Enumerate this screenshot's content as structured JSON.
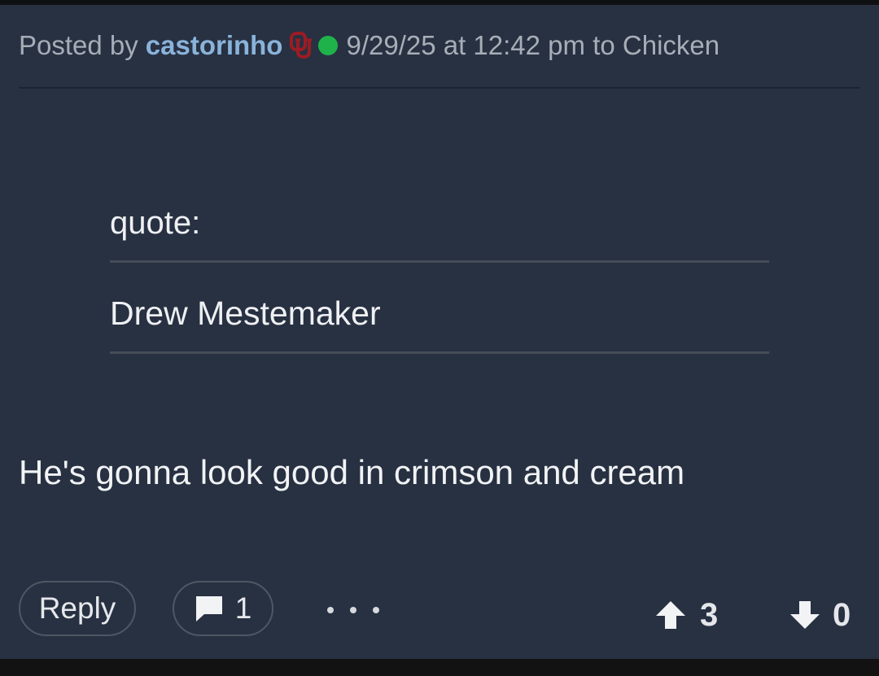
{
  "post": {
    "posted_by_label": "Posted by",
    "author": "castorinho",
    "date_text": "9/29/25 at 12:42 pm to Chicken",
    "quote_label": "quote:",
    "quote_author": "Drew Mestemaker",
    "body": "He's gonna look good in crimson and cream"
  },
  "actions": {
    "reply_label": "Reply",
    "comment_count": "1",
    "upvotes": "3",
    "downvotes": "0"
  },
  "icons": {
    "team_logo": "ou-logo-icon",
    "online_status": "online-dot-icon",
    "comment": "comment-icon",
    "more": "more-icon",
    "upvote": "arrow-up-icon",
    "downvote": "arrow-down-icon"
  },
  "colors": {
    "background": "#283142",
    "author": "#8ab3da",
    "online": "#1fb24a",
    "logo": "#9b1c24"
  }
}
